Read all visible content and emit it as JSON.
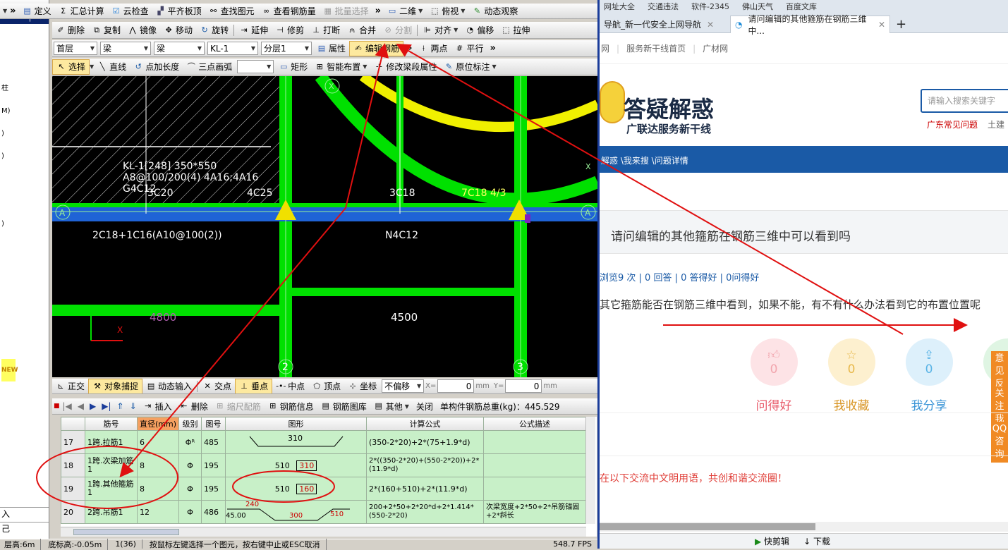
{
  "toolbar1": {
    "items": [
      "定义",
      "汇总计算",
      "云检查",
      "平齐板顶",
      "查找图元",
      "查看钢筋量",
      "批量选择",
      "二维",
      "俯视",
      "动态观察"
    ]
  },
  "toolbar2": {
    "items": [
      "删除",
      "复制",
      "镜像",
      "移动",
      "旋转",
      "延伸",
      "修剪",
      "打断",
      "合并",
      "分割",
      "对齐",
      "偏移",
      "拉伸"
    ]
  },
  "toolbar3": {
    "floor": "首层",
    "type1": "梁",
    "type2": "梁",
    "element": "KL-1",
    "layer": "分层1",
    "props": "属性",
    "edit_rebar": "编辑钢筋",
    "two_points": "两点",
    "parallel": "平行"
  },
  "toolbar4": {
    "items": [
      "选择",
      "直线",
      "点加长度",
      "三点画弧",
      "矩形",
      "智能布置",
      "修改梁段属性",
      "原位标注"
    ]
  },
  "left_panel": {
    "pin": "╀",
    "close": "✕",
    "items": [
      "柱",
      "M)",
      ")",
      ")",
      ")",
      "NEW",
      "入",
      "己"
    ]
  },
  "canvas": {
    "beam_label_1": "KL-1[248] 350*550",
    "beam_label_2": "A8@100/200(4) 4A16;4A16",
    "beam_label_3": "G4C12",
    "rebar_3c20": "3C20",
    "rebar_4c25": "4C25",
    "rebar_3c18": "3C18",
    "rebar_7c18": "7C18 4/3",
    "rebar_bottom": "2C18+1C16(A10@100(2))",
    "rebar_n4c12": "N4C12",
    "dim_4800": "4800",
    "dim_4500": "4500",
    "axis_2": "2",
    "axis_3": "3",
    "axis_a": "A",
    "axis_x": "X"
  },
  "snapbar": {
    "items": [
      "正交",
      "对象捕捉",
      "动态输入",
      "交点",
      "垂点",
      "中点",
      "顶点",
      "坐标"
    ],
    "offset": "不偏移",
    "x_label": "X=",
    "x_value": "0",
    "mm": "mm",
    "y_label": "Y=",
    "y_value": "0"
  },
  "rebar_toolbar": {
    "items": [
      "插入",
      "删除",
      "缩尺配筋",
      "钢筋信息",
      "钢筋图库",
      "其他",
      "关闭"
    ],
    "total_weight": "单构件钢筋总重(kg)：445.529"
  },
  "rebar_table": {
    "headers": [
      "筋号",
      "直径(mm)",
      "级别",
      "图号",
      "图形",
      "计算公式",
      "公式描述"
    ],
    "rows": [
      {
        "no": "17",
        "name": "1跨.拉筋1",
        "dia": "6",
        "grade": "Φᴿ",
        "fig": "485",
        "shape_val": "310",
        "formula": "(350-2*20)+2*(75+1.9*d)",
        "desc": ""
      },
      {
        "no": "18",
        "name": "1跨.次梁加筋1",
        "dia": "8",
        "grade": "Φ",
        "fig": "195",
        "shape_val": "510",
        "shape_red": "310",
        "formula": "2*((350-2*20)+(550-2*20))+2*(11.9*d)",
        "desc": ""
      },
      {
        "no": "19",
        "name": "1跨.其他箍筋1",
        "dia": "8",
        "grade": "Φ",
        "fig": "195",
        "shape_val": "510",
        "shape_red": "160",
        "formula": "2*(160+510)+2*(11.9*d)",
        "desc": ""
      },
      {
        "no": "20",
        "name": "2跨.吊筋1",
        "dia": "12",
        "grade": "Φ",
        "fig": "486",
        "shape_val": "45.00",
        "shape_a": "240",
        "shape_b": "300",
        "shape_c": "510",
        "formula": "200+2*50+2*20*d+2*1.414*(550-2*20)",
        "desc": "次梁宽度+2*50+2*吊筋锚固+2*斜长"
      }
    ]
  },
  "statusbar": {
    "items": [
      "层高:6m",
      "底标高:-0.05m",
      "1(36)",
      "按鼠标左键选择一个图元，按右键中止或ESC取消",
      "548.7 FPS"
    ]
  },
  "browser": {
    "favorites": [
      "网址大全",
      "交通违法",
      "软件-2345",
      "佛山天气",
      "百度文库"
    ],
    "tab1": "导航_新一代安全上网导航",
    "tab2": "请问编辑的其他箍筋在钢筋三维中...",
    "nav_links": [
      "网",
      "服务新干线首页",
      "广材网"
    ],
    "logo_title": "答疑解惑",
    "logo_sub": "广联达服务新干线",
    "search_placeholder": "请输入搜索关键字",
    "links": [
      "广东常见问题",
      "土建"
    ],
    "breadcrumb": "解惑 \\我来搜 \\问题详情",
    "question_title": "请问编辑的其他箍筋在钢筋三维中可以看到吗",
    "stats": "浏览9 次 | 0 回答 | 0 答得好 | 0问得好",
    "question_body": "其它箍筋能否在钢筋三维中看到，如果不能，有不有什么办法看到它的布置位置呢",
    "actions": [
      {
        "count": "0",
        "label": "问得好",
        "color": "#f2a5ad",
        "bg": "#fde3e6"
      },
      {
        "count": "0",
        "label": "我收藏",
        "color": "#e8b84a",
        "bg": "#fdf0cf"
      },
      {
        "count": "0",
        "label": "我分享",
        "color": "#5ab4e6",
        "bg": "#ddf0fb"
      }
    ],
    "side_tabs": [
      "意见反馈",
      "关注我们",
      "QQ咨询"
    ],
    "notice": "在以下交流中文明用语，共创和谐交流圈！",
    "bottom_items": [
      "快剪辑",
      "下载"
    ]
  },
  "colors": {
    "beam_green": "#00e000",
    "blue_beam": "#1f63d6",
    "yellow": "#f0f000",
    "annotation_red": "#e01010",
    "nav_blue": "#1a5aa6"
  }
}
